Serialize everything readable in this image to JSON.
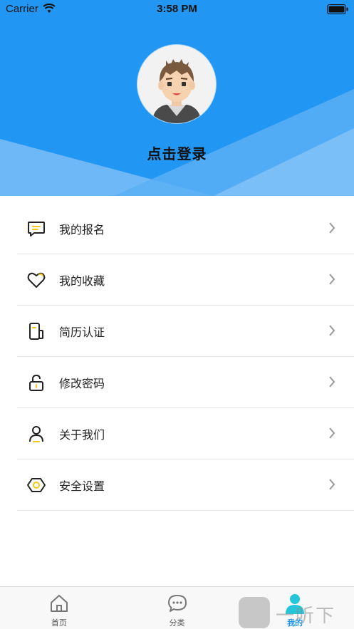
{
  "status_bar": {
    "carrier": "Carrier",
    "time": "3:58 PM"
  },
  "profile": {
    "login_prompt": "点击登录"
  },
  "menu": {
    "items": [
      {
        "label": "我的报名",
        "icon": "message-icon"
      },
      {
        "label": "我的收藏",
        "icon": "heart-icon"
      },
      {
        "label": "简历认证",
        "icon": "resume-icon"
      },
      {
        "label": "修改密码",
        "icon": "lock-icon"
      },
      {
        "label": "关于我们",
        "icon": "user-icon"
      },
      {
        "label": "安全设置",
        "icon": "shield-icon"
      }
    ]
  },
  "tabbar": {
    "tabs": [
      {
        "label": "首页",
        "icon": "home-icon"
      },
      {
        "label": "分类",
        "icon": "chat-icon"
      },
      {
        "label": "我的",
        "icon": "profile-icon",
        "active": true
      }
    ]
  },
  "watermark": {
    "text": "一听下载"
  },
  "colors": {
    "primary": "#2196f3",
    "accent": "#f5c518"
  }
}
